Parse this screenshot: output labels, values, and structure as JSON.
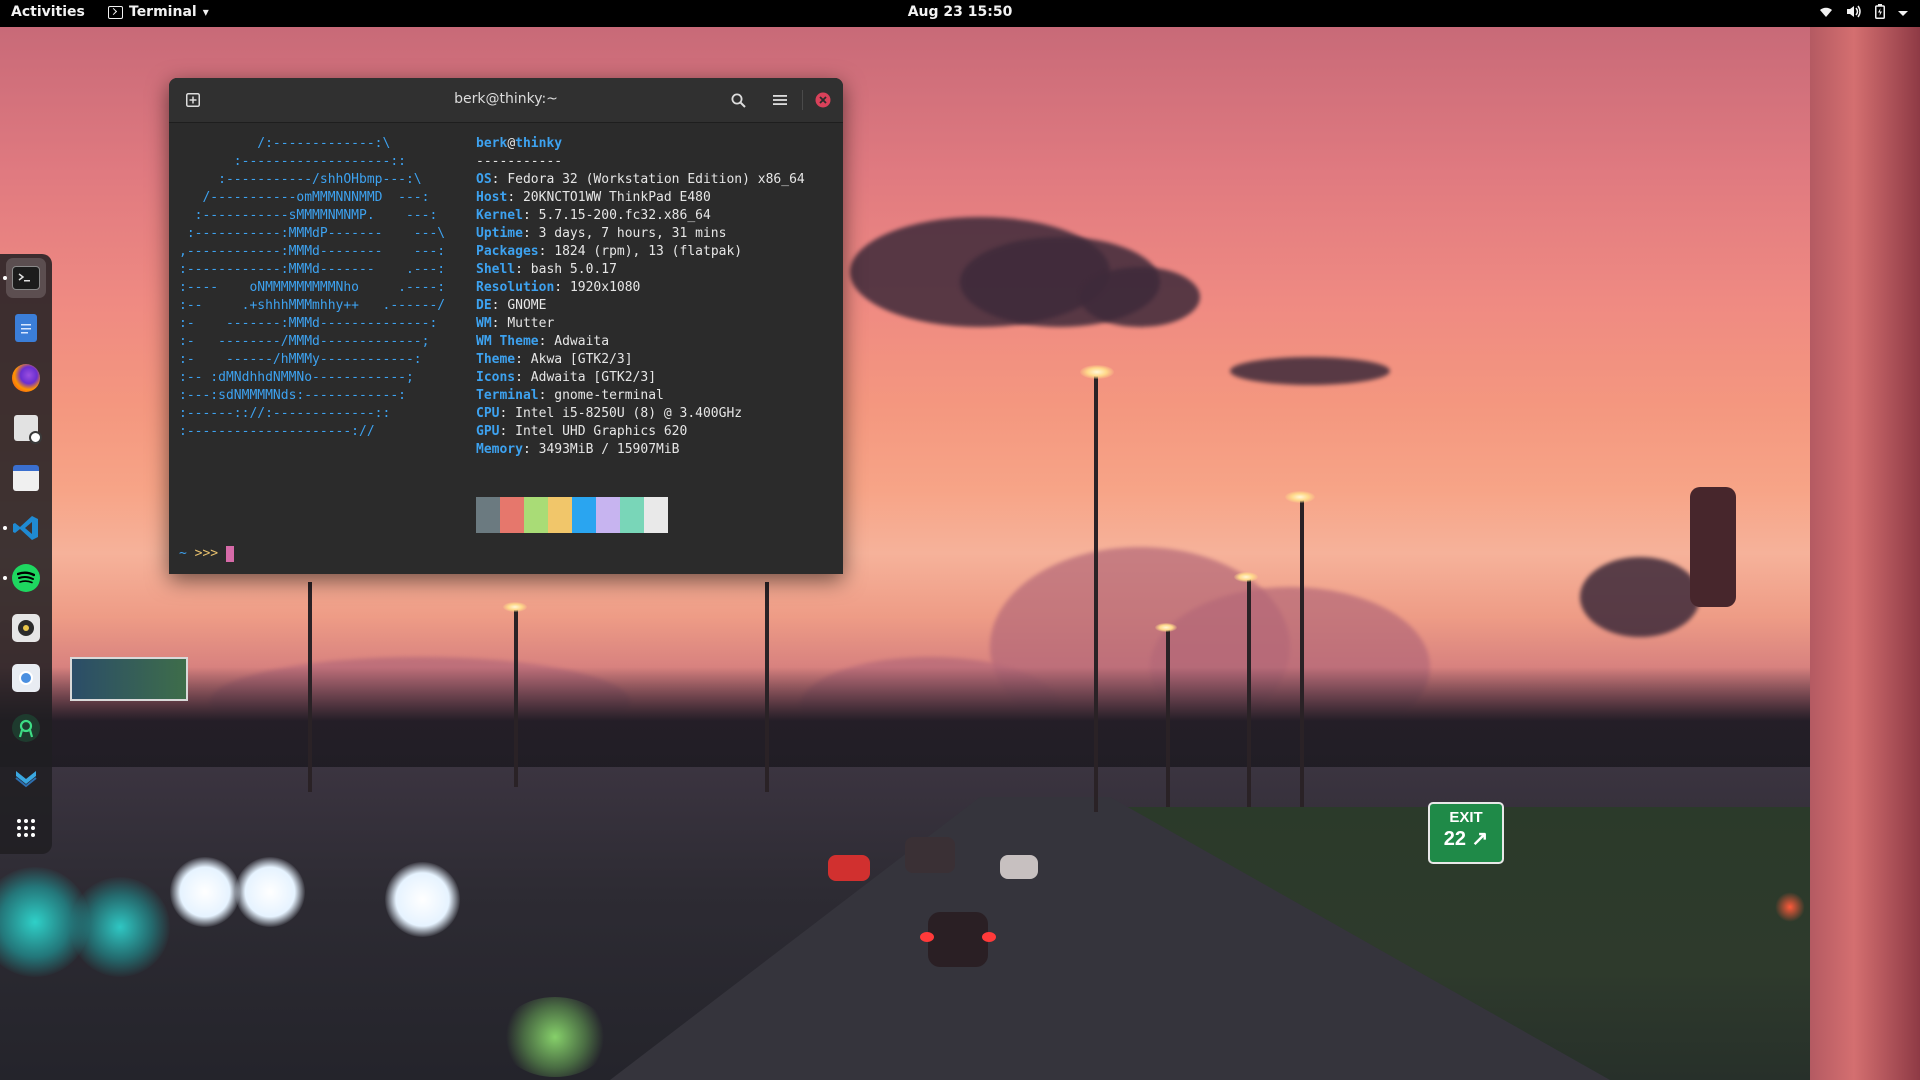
{
  "topbar": {
    "activities": "Activities",
    "app_name": "Terminal",
    "app_arrow": "▾",
    "clock": "Aug 23  15:50",
    "status_icons": [
      "wifi-icon",
      "volume-icon",
      "battery-icon",
      "chevron-down-icon"
    ]
  },
  "dock": {
    "items": [
      {
        "name": "terminal",
        "icon": "terminal-icon",
        "color": "#2b2b2b",
        "running": true
      },
      {
        "name": "text-editor",
        "icon": "text-editor-icon",
        "color": "#3b7ed8",
        "running": false
      },
      {
        "name": "firefox",
        "icon": "firefox-icon",
        "color": "#e8562b",
        "running": false
      },
      {
        "name": "files",
        "icon": "files-icon",
        "color": "#d9d9d9",
        "running": false
      },
      {
        "name": "calendar",
        "icon": "calendar-icon",
        "color": "#3a6fcf",
        "running": false
      },
      {
        "name": "vscode",
        "icon": "vscode-icon",
        "color": "#1f8ad2",
        "running": true
      },
      {
        "name": "spotify",
        "icon": "spotify-icon",
        "color": "#1ed760",
        "running": true
      },
      {
        "name": "rhythmbox",
        "icon": "music-player-icon",
        "color": "#e9c64a",
        "running": false
      },
      {
        "name": "screenshot",
        "icon": "screenshot-icon",
        "color": "#4a8fe0",
        "running": false
      },
      {
        "name": "android-studio",
        "icon": "android-studio-icon",
        "color": "#3ddc84",
        "running": false
      },
      {
        "name": "mailspring",
        "icon": "mail-icon",
        "color": "#3aa7e0",
        "running": false
      },
      {
        "name": "show-apps",
        "icon": "app-grid-icon",
        "color": "#ffffff",
        "running": false
      }
    ]
  },
  "terminal": {
    "title": "berk@thinky:~",
    "ascii_art": [
      "          /:-------------:\\",
      "       :-------------------::",
      "     :-----------/shhOHbmp---:\\",
      "   /-----------omMMMNNNMMD  ---:",
      "  :-----------sMMMMNMNMP.    ---:",
      " :-----------:MMMdP-------    ---\\",
      ",------------:MMMd--------    ---:",
      ":------------:MMMd-------    .---:",
      ":----    oNMMMMMMMMMNho     .----:",
      ":--     .+shhhMMMmhhy++   .------/",
      ":-    -------:MMMd--------------:",
      ":-   --------/MMMd-------------;",
      ":-    ------/hMMMy------------:",
      ":-- :dMNdhhdNMMNo------------;",
      ":---:sdNMMMMNds:------------:",
      ":------:://:-------------::",
      ":---------------------://"
    ],
    "neofetch": {
      "user": "berk",
      "at": "@",
      "host": "thinky",
      "separator": "-----------",
      "fields": [
        {
          "key": "OS",
          "value": "Fedora 32 (Workstation Edition) x86_64"
        },
        {
          "key": "Host",
          "value": "20KNCTO1WW ThinkPad E480"
        },
        {
          "key": "Kernel",
          "value": "5.7.15-200.fc32.x86_64"
        },
        {
          "key": "Uptime",
          "value": "3 days, 7 hours, 31 mins"
        },
        {
          "key": "Packages",
          "value": "1824 (rpm), 13 (flatpak)"
        },
        {
          "key": "Shell",
          "value": "bash 5.0.17"
        },
        {
          "key": "Resolution",
          "value": "1920x1080"
        },
        {
          "key": "DE",
          "value": "GNOME"
        },
        {
          "key": "WM",
          "value": "Mutter"
        },
        {
          "key": "WM Theme",
          "value": "Adwaita"
        },
        {
          "key": "Theme",
          "value": "Akwa [GTK2/3]"
        },
        {
          "key": "Icons",
          "value": "Adwaita [GTK2/3]"
        },
        {
          "key": "Terminal",
          "value": "gnome-terminal"
        },
        {
          "key": "CPU",
          "value": "Intel i5-8250U (8) @ 3.400GHz"
        },
        {
          "key": "GPU",
          "value": "Intel UHD Graphics 620"
        },
        {
          "key": "Memory",
          "value": "3493MiB / 15907MiB"
        }
      ],
      "palette": [
        "#6b7a80",
        "#e6776c",
        "#a9dc76",
        "#f1c66a",
        "#2aa5f0",
        "#c7b4f0",
        "#79d6b8",
        "#e9e9e9"
      ]
    },
    "prompt": {
      "tilde": "~",
      "arrows": ">>>"
    },
    "header_icons": [
      "new-tab-icon",
      "search-icon",
      "hamburger-menu-icon",
      "close-icon"
    ]
  },
  "wallpaper": {
    "exit_sign": {
      "line1": "EXIT",
      "line2": "22 ↗"
    }
  }
}
